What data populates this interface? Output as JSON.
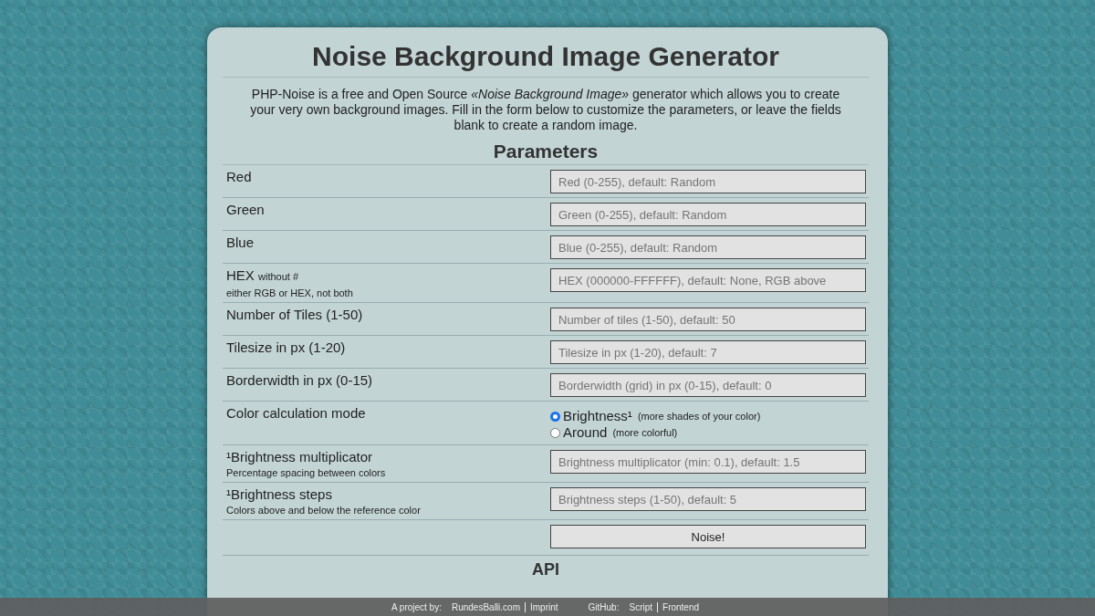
{
  "title": "Noise Background Image Generator",
  "intro": "PHP-Noise is a free and Open Source *«Noise Background Image»* generator which allows you to create your very own background images. Fill in the form below to customize the parameters, or leave the fields blank to create a random image.",
  "section_title": "Parameters",
  "rows": [
    {
      "kind": "field",
      "label": "Red",
      "placeholder": "Red (0-255), default: Random"
    },
    {
      "kind": "field",
      "label": "Green",
      "placeholder": "Green (0-255), default: Random"
    },
    {
      "kind": "field",
      "label": "Blue",
      "placeholder": "Blue (0-255), default: Random"
    },
    {
      "kind": "field",
      "label": "HEX",
      "note": "without #",
      "hint": "either RGB or HEX, not both",
      "placeholder": "HEX (000000-FFFFFF), default: None, RGB above"
    },
    {
      "kind": "field",
      "label": "Number of Tiles (1-50)",
      "placeholder": "Number of tiles (1-50), default: 50"
    },
    {
      "kind": "field",
      "label": "Tilesize in px (1-20)",
      "placeholder": "Tilesize in px (1-20), default: 7"
    },
    {
      "kind": "field",
      "label": "Borderwidth in px (0-15)",
      "placeholder": "Borderwidth (grid) in px (0-15), default: 0"
    },
    {
      "kind": "radio",
      "label": "Color calculation mode",
      "options": [
        {
          "label": "Brightness¹",
          "note": "(more shades of your color)",
          "selected": true
        },
        {
          "label": "Around",
          "note": "(more colorful)",
          "selected": false
        }
      ]
    },
    {
      "kind": "field",
      "label": "¹Brightness multiplicator",
      "hint": "Percentage spacing between colors",
      "placeholder": "Brightness multiplicator (min: 0.1), default: 1.5"
    },
    {
      "kind": "field",
      "label": "¹Brightness steps",
      "hint": "Colors above and below the reference color",
      "placeholder": "Brightness steps (1-50), default: 5"
    },
    {
      "kind": "button",
      "label": "Noise!"
    }
  ],
  "api_heading": "API",
  "footer": {
    "project_label": "A project by:",
    "links": [
      {
        "label": "RundesBalli.com"
      },
      {
        "label": "Imprint"
      }
    ],
    "github_label": "GitHub:",
    "github_links": [
      {
        "label": "Script"
      },
      {
        "label": "Frontend"
      }
    ]
  }
}
